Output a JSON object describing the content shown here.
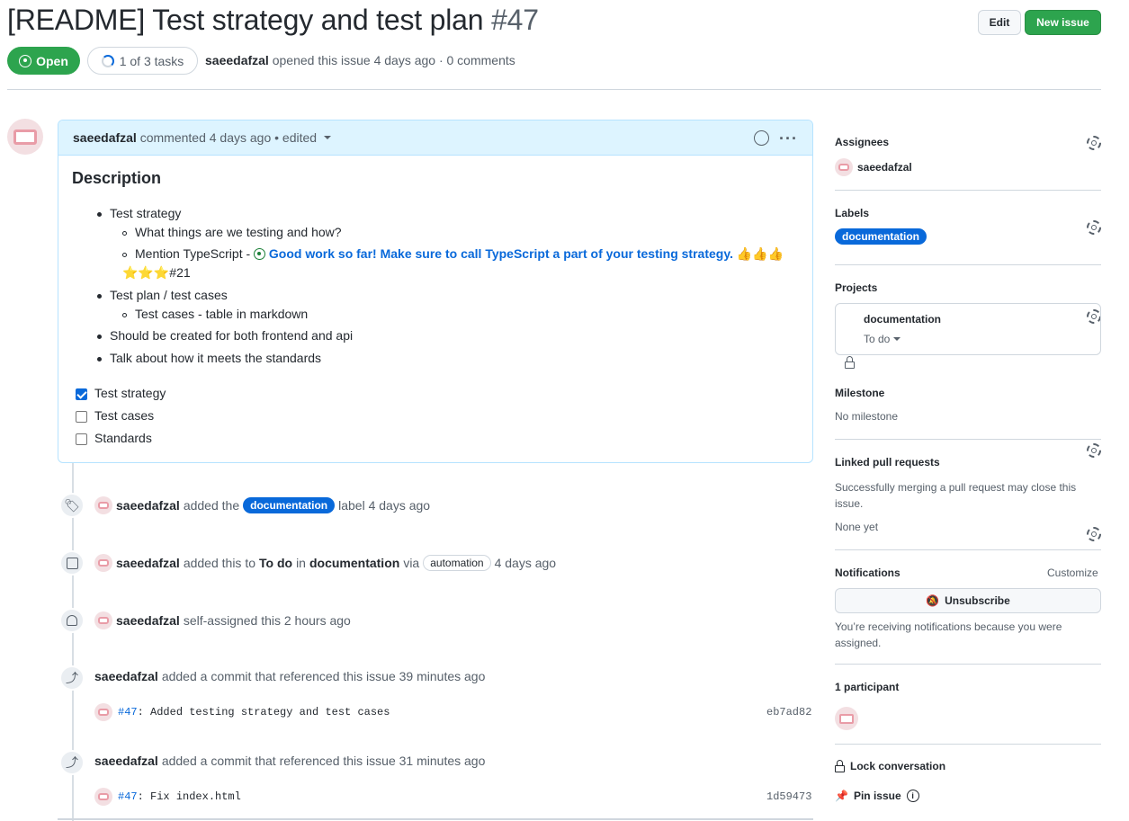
{
  "header": {
    "title": "[README] Test strategy and test plan",
    "number": "#47",
    "edit_label": "Edit",
    "new_issue_label": "New issue",
    "state_label": "Open",
    "tasks_label": "1 of 3 tasks",
    "author": "saeedafzal",
    "meta_text": "opened this issue 4 days ago · 0 comments"
  },
  "comment": {
    "author": "saeedafzal",
    "meta": "commented 4 days ago • edited",
    "heading": "Description",
    "items": {
      "l1": "Test strategy",
      "l1a": "What things are we testing and how?",
      "l1b_prefix": "Mention TypeScript -",
      "l1b_link": "Good work so far! Make sure to call TypeScript a part of your testing strategy.",
      "l1b_thumbs": "👍👍👍",
      "l1b_stars": "⭐⭐⭐",
      "l1b_ref": "#21",
      "l2": "Test plan / test cases",
      "l2a": "Test cases - table in markdown",
      "l3": "Should be created for both frontend and api",
      "l4": "Talk about how it meets the standards"
    },
    "checklist": [
      {
        "label": "Test strategy",
        "checked": true
      },
      {
        "label": "Test cases",
        "checked": false
      },
      {
        "label": "Standards",
        "checked": false
      }
    ]
  },
  "events": {
    "e1": {
      "user": "saeedafzal",
      "pre": "added the",
      "label": "documentation",
      "post": "label 4 days ago"
    },
    "e2": {
      "user": "saeedafzal",
      "pre": "added this to",
      "col": "To do",
      "in": "in",
      "project": "documentation",
      "via": "via",
      "pill": "automation",
      "time": "4 days ago"
    },
    "e3": {
      "user": "saeedafzal",
      "text": "self-assigned this 2 hours ago"
    },
    "e4": {
      "user": "saeedafzal",
      "text": "added a commit that referenced this issue 39 minutes ago",
      "ref": "#47",
      "msg": ": Added testing strategy and test cases",
      "sha": "eb7ad82"
    },
    "e5": {
      "user": "saeedafzal",
      "text": "added a commit that referenced this issue 31 minutes ago",
      "ref": "#47",
      "msg": ": Fix index.html",
      "sha": "1d59473"
    }
  },
  "sidebar": {
    "assignees_h": "Assignees",
    "assignee": "saeedafzal",
    "labels_h": "Labels",
    "label": "documentation",
    "projects_h": "Projects",
    "project_name": "documentation",
    "project_col": "To do",
    "milestone_h": "Milestone",
    "milestone": "No milestone",
    "linked_h": "Linked pull requests",
    "linked_text": "Successfully merging a pull request may close this issue.",
    "linked_none": "None yet",
    "notif_h": "Notifications",
    "customize": "Customize",
    "unsubscribe": "Unsubscribe",
    "notif_text": "You’re receiving notifications because you were assigned.",
    "participants": "1 participant",
    "lock": "Lock conversation",
    "pin": "Pin issue"
  },
  "colors": {
    "accent": "#0969da",
    "success": "#2da44e",
    "comment_bg": "#ddf4ff"
  }
}
